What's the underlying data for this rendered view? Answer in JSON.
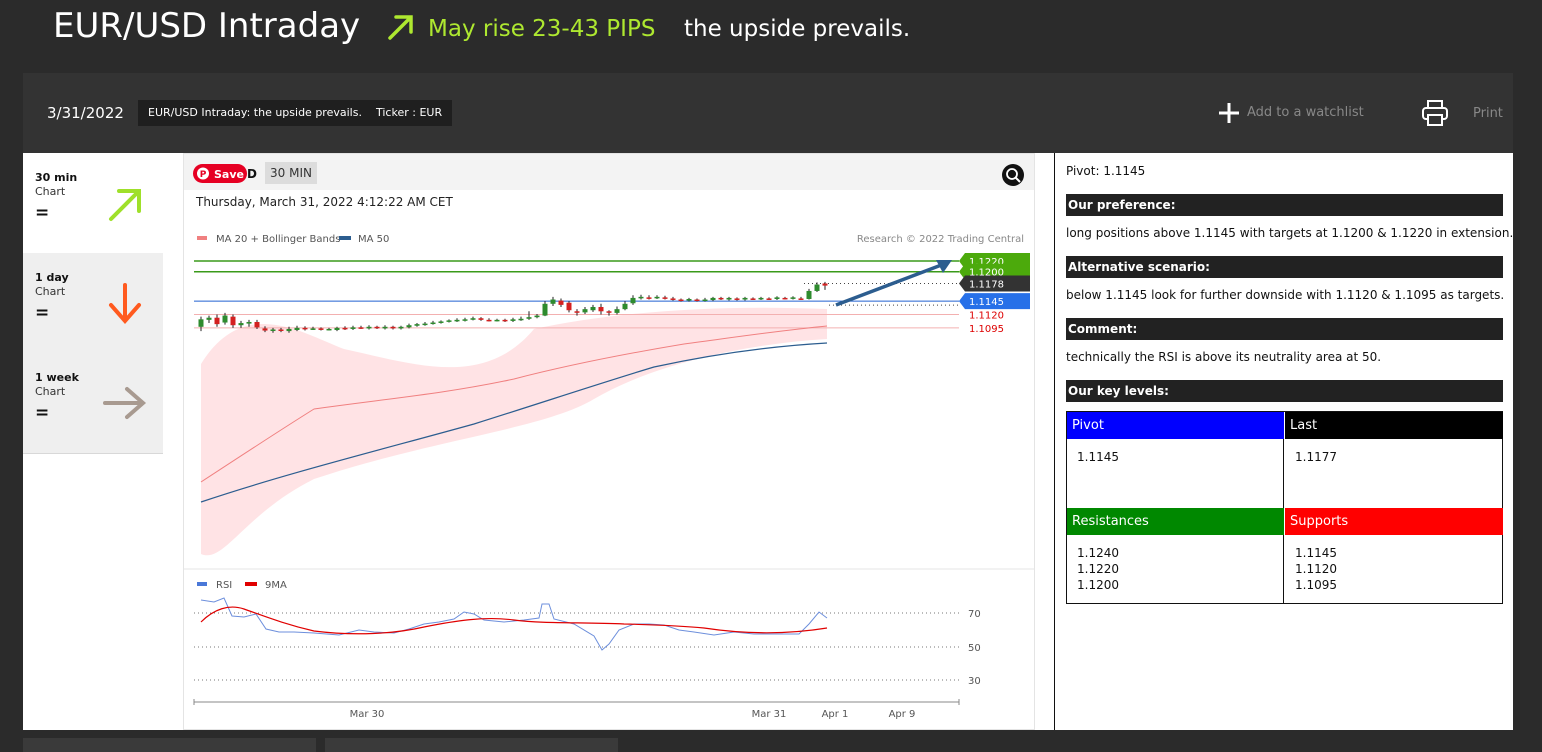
{
  "header": {
    "title": "EUR/USD Intraday",
    "arrow_icon": "arrow-up-right-icon",
    "rise_text": "May rise 23-43 PIPS",
    "tagline": "the upside prevails.",
    "accent_color": "#aee830"
  },
  "bar": {
    "date": "3/31/2022",
    "chip_title": "EUR/USD Intraday: the upside prevails.",
    "chip_ticker": "Ticker : EUR",
    "watchlist_label": "Add to a watchlist",
    "print_label": "Print"
  },
  "timeframes": [
    {
      "name": "30 min",
      "sub": "Chart",
      "value": "=",
      "icon": "arrow-up-right-icon",
      "color": "#9fe02a"
    },
    {
      "name": "1 day",
      "sub": "Chart",
      "value": "=",
      "icon": "arrow-down-icon",
      "color": "#ff5a1f"
    },
    {
      "name": "1 week",
      "sub": "Chart",
      "value": "=",
      "icon": "arrow-right-icon",
      "color": "#a89a90"
    }
  ],
  "chart": {
    "save_label": "Save",
    "symbol_tail": "D",
    "interval": "30 MIN",
    "timestamp": "Thursday, March 31, 2022 4:12:22 AM CET",
    "legend_ma20": "MA 20 + Bollinger Bands",
    "legend_ma50": "MA 50",
    "credit": "Research © 2022 Trading Central",
    "rsi_legend": "RSI",
    "ma_legend": "9MA",
    "x_labels": [
      "Mar 30",
      "Mar 31",
      "Apr 1",
      "Apr 9"
    ],
    "rsi_ticks": [
      "70",
      "50",
      "30"
    ]
  },
  "chart_data": {
    "type": "candlestick",
    "levels": [
      {
        "label": "1.1220",
        "value": 1.122,
        "kind": "target"
      },
      {
        "label": "1.1200",
        "value": 1.12,
        "kind": "target"
      },
      {
        "label": "1.1178",
        "value": 1.1178,
        "kind": "last"
      },
      {
        "label": "1.1145",
        "value": 1.1145,
        "kind": "pivot"
      },
      {
        "label": "1.1120",
        "value": 1.112,
        "kind": "support"
      },
      {
        "label": "1.1095",
        "value": 1.1095,
        "kind": "support"
      }
    ],
    "rsi_range": [
      30,
      70
    ]
  },
  "analysis": {
    "pivot_line": "Pivot: 1.1145",
    "pref_head": "Our preference:",
    "pref_text": "long positions above 1.1145 with targets at 1.1200 & 1.1220 in extension.",
    "alt_head": "Alternative scenario:",
    "alt_text": "below 1.1145 look for further downside with 1.1120 & 1.1095 as targets.",
    "comment_head": "Comment:",
    "comment_text": "technically the RSI is above its neutrality area at 50.",
    "levels_head": "Our key levels:",
    "table": {
      "pivot_h": "Pivot",
      "last_h": "Last",
      "pivot_v": "1.1145",
      "last_v": "1.1177",
      "res_h": "Resistances",
      "sup_h": "Supports",
      "res_v": "1.1240\n1.1220\n1.1200",
      "sup_v": "1.1145\n1.1120\n1.1095",
      "pivot_color": "#0000ff",
      "last_color": "#000000",
      "res_color": "#008800",
      "sup_color": "#ff0000"
    }
  }
}
